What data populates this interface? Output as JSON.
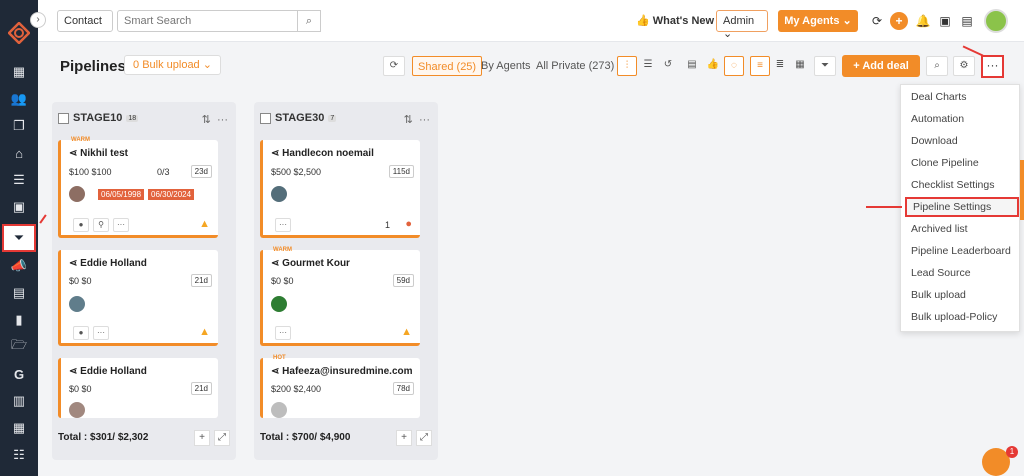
{
  "topbar": {
    "contact_select": "Contact",
    "search_placeholder": "Smart Search",
    "whats_new": "What's New",
    "role_select": "Admin",
    "my_agents": "My Agents"
  },
  "header": {
    "title": "Pipelines",
    "bulk_upload": "0 Bulk upload",
    "filters": [
      "Shared (25)",
      "By Agents",
      "All Private (273)"
    ],
    "add_deal": "Add deal"
  },
  "columns": [
    {
      "name": "STAGE10",
      "count": "18",
      "total": "Total : $301/ $2,302",
      "cards": [
        {
          "tag": "WARM",
          "name": "Nikhil test",
          "values": "$100  $100",
          "progress": "0/3",
          "days": "23d",
          "dates": [
            "06/05/1998",
            "06/30/2024"
          ]
        },
        {
          "tag": "",
          "name": "Eddie Holland",
          "values": "$0  $0",
          "days": "21d"
        },
        {
          "tag": "",
          "name": "Eddie Holland",
          "values": "$0  $0",
          "days": "21d"
        }
      ]
    },
    {
      "name": "STAGE30",
      "count": "7",
      "total": "Total : $700/ $4,900",
      "cards": [
        {
          "tag": "",
          "name": "Handlecon noemail",
          "values": "$500  $2,500",
          "days": "115d",
          "count": "1"
        },
        {
          "tag": "WARM",
          "name": "Gourmet Kour",
          "values": "$0  $0",
          "days": "59d"
        },
        {
          "tag": "HOT",
          "name": "Hafeeza@insuredmine.com",
          "values": "$200  $2,400",
          "days": "78d"
        }
      ]
    }
  ],
  "menu": {
    "items": [
      "Deal Charts",
      "Automation",
      "Download",
      "Clone Pipeline",
      "Checklist Settings",
      "Pipeline Settings",
      "Archived list",
      "Pipeline Leaderboard",
      "Lead Source",
      "Bulk upload",
      "Bulk upload-Policy"
    ]
  },
  "chat_badge": "1",
  "colors": {
    "accent": "#f28c28",
    "highlight": "#e53935",
    "sidebar": "#1f2937"
  }
}
